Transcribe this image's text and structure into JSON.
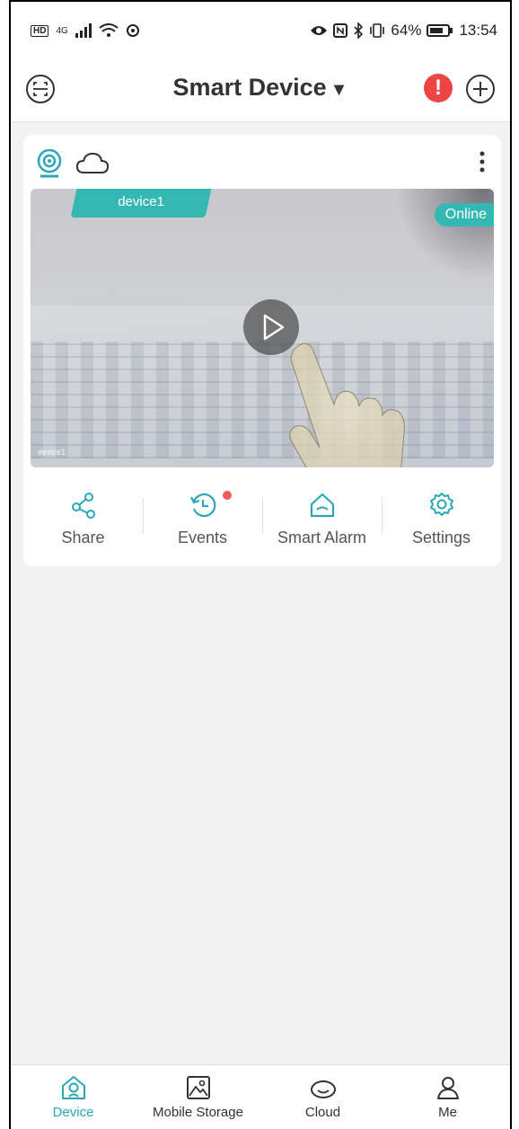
{
  "status_bar": {
    "left_badge": "HD",
    "network": "4G",
    "battery_percent": "64%",
    "time": "13:54"
  },
  "header": {
    "title": "Smart Device",
    "alert_glyph": "!",
    "icons": [
      "scan-icon",
      "alert-icon",
      "add-icon"
    ]
  },
  "device_card": {
    "device_name": "device1",
    "status": "Online",
    "watermark": "device1",
    "icons": [
      "camera-icon",
      "cloud-icon",
      "more-icon",
      "play-icon"
    ],
    "actions": [
      {
        "label": "Share",
        "icon": "share-icon",
        "has_badge": false
      },
      {
        "label": "Events",
        "icon": "history-icon",
        "has_badge": true
      },
      {
        "label": "Smart Alarm",
        "icon": "home-alarm-icon",
        "has_badge": false
      },
      {
        "label": "Settings",
        "icon": "gear-icon",
        "has_badge": false
      }
    ]
  },
  "bottom_nav": {
    "active": "Device",
    "items": [
      {
        "label": "Device",
        "icon": "device-icon"
      },
      {
        "label": "Mobile Storage",
        "icon": "image-icon"
      },
      {
        "label": "Cloud",
        "icon": "cloud-icon"
      },
      {
        "label": "Me",
        "icon": "person-icon"
      }
    ]
  },
  "colors": {
    "accent": "#35b8b3",
    "alert": "#ee4444",
    "nav_active": "#2aa8b8",
    "badge_dot": "#ef5a5a"
  }
}
